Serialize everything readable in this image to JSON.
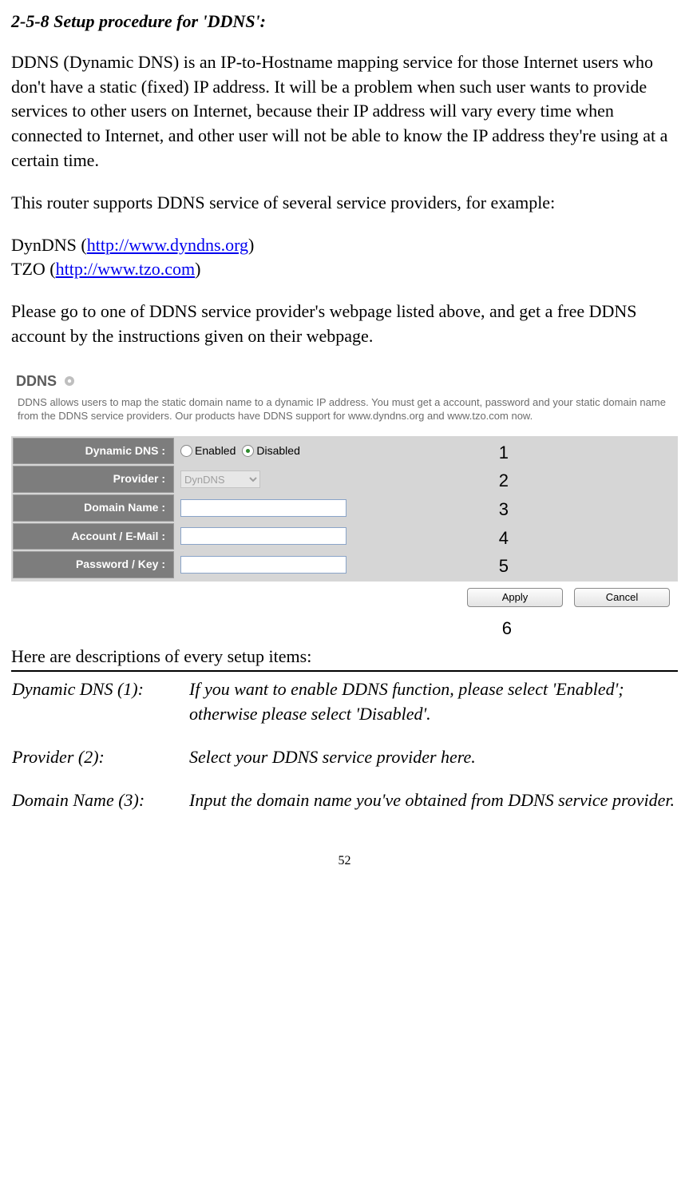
{
  "heading": "2-5-8 Setup procedure for 'DDNS':",
  "para1": "DDNS (Dynamic DNS) is an IP-to-Hostname mapping service for those Internet users who don't have a static (fixed) IP address. It will be a problem when such user wants to provide services to other users on Internet, because their IP address will vary every time when connected to Internet, and other user will not be able to know the IP address they're using at a certain time.",
  "para2": "This router supports DDNS service of several service providers, for example:",
  "link1_prefix": "DynDNS (",
  "link1_url": "http://www.dyndns.org",
  "link1_suffix": ")",
  "link2_prefix": "TZO (",
  "link2_url": "http://www.tzo.com",
  "link2_suffix": ")",
  "para3": "Please go to one of DDNS service provider's webpage listed above, and get a free DDNS account by the instructions given on their webpage.",
  "panel": {
    "title": "DDNS",
    "description": "DDNS allows users to map the static domain name to a dynamic IP address. You must get a account, password and your static domain name from the DDNS service providers. Our products have DDNS support for www.dyndns.org and www.tzo.com now.",
    "labels": {
      "dynamic_dns": "Dynamic DNS :",
      "provider": "Provider :",
      "domain_name": "Domain Name :",
      "account": "Account / E-Mail :",
      "password": "Password / Key :"
    },
    "radio": {
      "enabled": "Enabled",
      "disabled": "Disabled"
    },
    "provider_value": "DynDNS",
    "numbers": [
      "1",
      "2",
      "3",
      "4",
      "5"
    ],
    "number_six": "6",
    "buttons": {
      "apply": "Apply",
      "cancel": "Cancel"
    }
  },
  "desc_intro": "Here are descriptions of every setup items:",
  "descriptions": [
    {
      "term": "Dynamic DNS (1):",
      "def": "If you want to enable DDNS function, please select 'Enabled'; otherwise please select 'Disabled'."
    },
    {
      "term": "Provider (2):",
      "def": "Select your DDNS service provider here."
    },
    {
      "term": "Domain Name (3):",
      "def": "Input the domain name you've obtained from DDNS service provider."
    }
  ],
  "page_number": "52"
}
